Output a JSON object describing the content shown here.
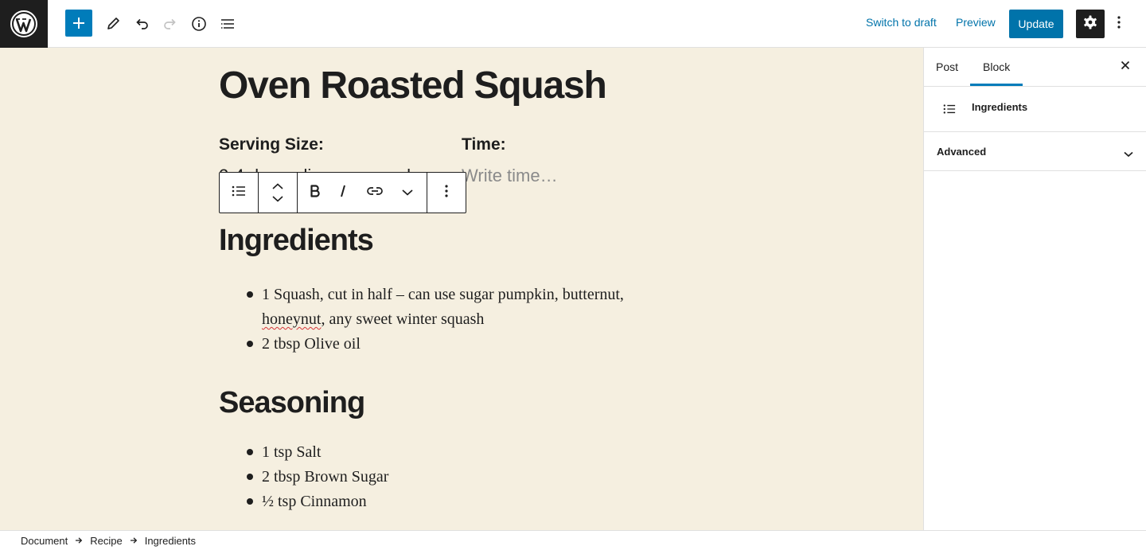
{
  "topbar": {
    "switch_to_draft": "Switch to draft",
    "preview": "Preview",
    "update": "Update",
    "icons": [
      "wordpress-logo",
      "plus-icon",
      "pencil-icon",
      "undo-icon",
      "redo-icon",
      "info-icon",
      "list-view-icon",
      "gear-icon",
      "more-vertical-icon"
    ],
    "accent": "#007cba"
  },
  "editor": {
    "background": "#f5efe0",
    "title": "Oven Roasted Squash",
    "serving_size_label": "Serving Size:",
    "serving_size_value": "2-4 depending on squash",
    "time_label": "Time:",
    "time_placeholder": "Write time…",
    "ingredients_heading": "Ingredients",
    "ingredients": [
      {
        "line1": "1 Squash, cut in half – can use sugar pumpkin, butternut,",
        "misspelled": "honeynut",
        "rest": ", any sweet winter squash"
      },
      {
        "text": "2 tbsp Olive oil"
      }
    ],
    "seasoning_heading": "Seasoning",
    "seasoning": [
      "1 tsp Salt",
      "2 tbsp Brown Sugar",
      "½ tsp Cinnamon"
    ]
  },
  "block_toolbar": {
    "icons": [
      "list-icon",
      "move-up-icon",
      "move-down-icon",
      "bold-icon",
      "italic-icon",
      "link-icon",
      "chevron-down-icon",
      "more-vertical-icon"
    ]
  },
  "sidebar": {
    "tabs": [
      "Post",
      "Block"
    ],
    "active_tab": "Block",
    "block_name": "Ingredients",
    "panels": [
      "Advanced"
    ]
  },
  "breadcrumb": [
    "Document",
    "Recipe",
    "Ingredients"
  ]
}
